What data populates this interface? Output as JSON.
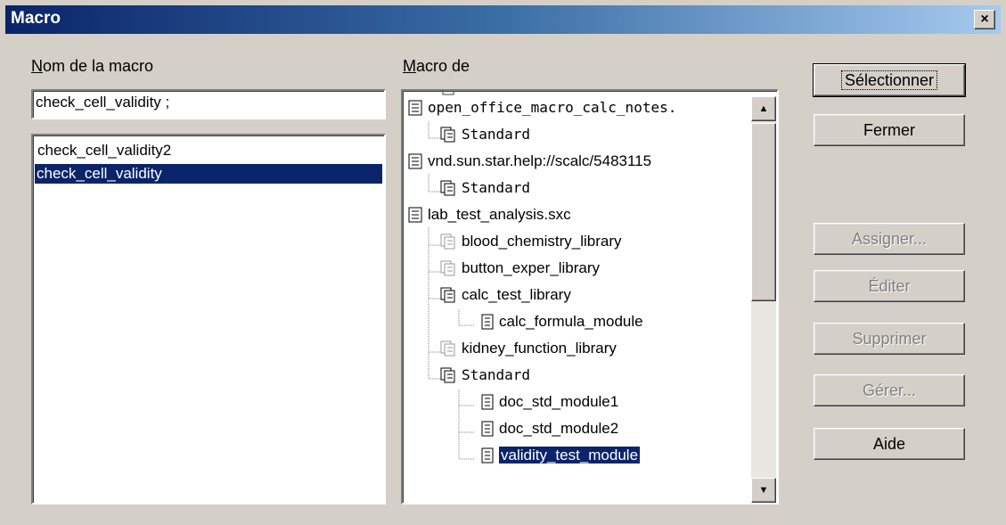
{
  "window": {
    "title": "Macro",
    "close_symbol": "×"
  },
  "left": {
    "label_first": "N",
    "label_rest": "om de la macro",
    "input_value": "check_cell_validity  ;",
    "items": [
      "check_cell_validity2",
      "check_cell_validity"
    ]
  },
  "middle": {
    "label_first": "M",
    "label_rest": "acro de",
    "tree": [
      {
        "label": "open_office_macro_calc_notes."
      },
      {
        "label": "Standard"
      },
      {
        "label": "vnd.sun.star.help://scalc/5483115"
      },
      {
        "label": "Standard"
      },
      {
        "label": "lab_test_analysis.sxc"
      },
      {
        "label": "blood_chemistry_library"
      },
      {
        "label": "button_exper_library"
      },
      {
        "label": "calc_test_library"
      },
      {
        "label": "calc_formula_module"
      },
      {
        "label": "kidney_function_library"
      },
      {
        "label": "Standard"
      },
      {
        "label": "doc_std_module1"
      },
      {
        "label": "doc_std_module2"
      },
      {
        "label": "validity_test_module"
      }
    ]
  },
  "buttons": {
    "select": "Sélectionner",
    "close": "Fermer",
    "assign": "Assigner...",
    "edit": "Éditer",
    "delete": "Supprimer",
    "manage": "Gérer...",
    "help": "Aide"
  },
  "colors": {
    "selection": "#0a246a",
    "face": "#d4d0c8",
    "title_start": "#0a246a",
    "title_end": "#a6caf0"
  }
}
